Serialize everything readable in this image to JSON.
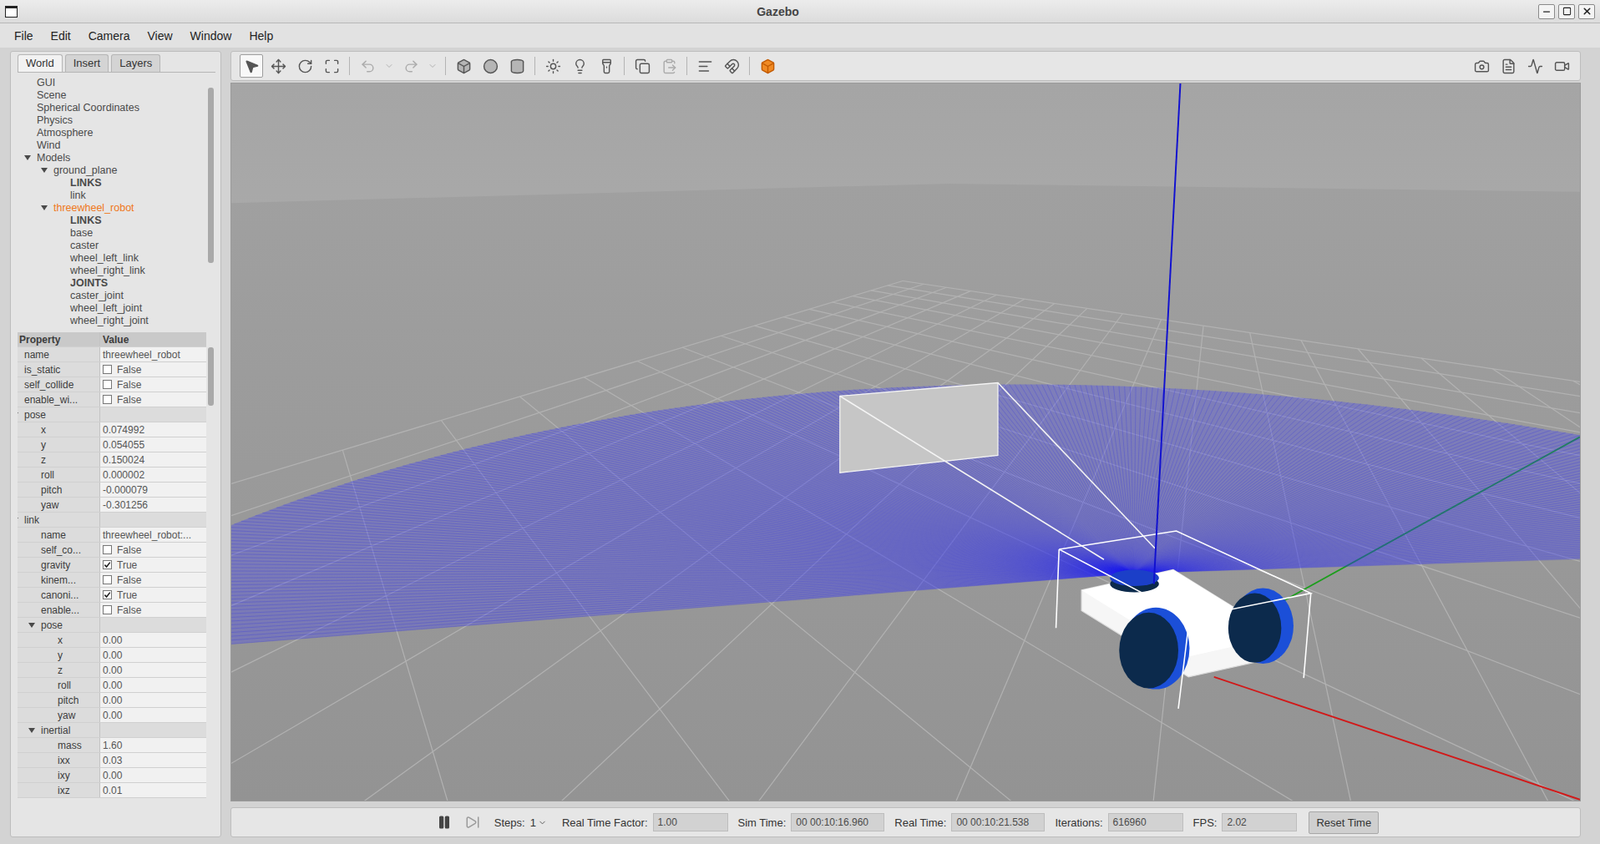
{
  "window": {
    "title": "Gazebo"
  },
  "menu": [
    "File",
    "Edit",
    "Camera",
    "View",
    "Window",
    "Help"
  ],
  "left_panel": {
    "tabs": [
      {
        "label": "World",
        "selected": true
      },
      {
        "label": "Insert",
        "selected": false
      },
      {
        "label": "Layers",
        "selected": false
      }
    ],
    "tree": [
      {
        "label": "GUI",
        "depth": 0,
        "kind": "item",
        "expandable": false,
        "expanded": false,
        "selected": false
      },
      {
        "label": "Scene",
        "depth": 0,
        "kind": "item",
        "expandable": false,
        "expanded": false,
        "selected": false
      },
      {
        "label": "Spherical Coordinates",
        "depth": 0,
        "kind": "item",
        "expandable": false,
        "expanded": false,
        "selected": false
      },
      {
        "label": "Physics",
        "depth": 0,
        "kind": "item",
        "expandable": false,
        "expanded": false,
        "selected": false
      },
      {
        "label": "Atmosphere",
        "depth": 0,
        "kind": "item",
        "expandable": false,
        "expanded": false,
        "selected": false
      },
      {
        "label": "Wind",
        "depth": 0,
        "kind": "item",
        "expandable": false,
        "expanded": false,
        "selected": false
      },
      {
        "label": "Models",
        "depth": 0,
        "kind": "item",
        "expandable": true,
        "expanded": true,
        "selected": false
      },
      {
        "label": "ground_plane",
        "depth": 1,
        "kind": "item",
        "expandable": true,
        "expanded": true,
        "selected": false
      },
      {
        "label": "LINKS",
        "depth": 2,
        "kind": "section",
        "expandable": false,
        "expanded": false,
        "selected": false
      },
      {
        "label": "link",
        "depth": 2,
        "kind": "item",
        "expandable": false,
        "expanded": false,
        "selected": false
      },
      {
        "label": "threewheel_robot",
        "depth": 1,
        "kind": "item",
        "expandable": true,
        "expanded": true,
        "selected": true
      },
      {
        "label": "LINKS",
        "depth": 2,
        "kind": "section",
        "expandable": false,
        "expanded": false,
        "selected": false
      },
      {
        "label": "base",
        "depth": 2,
        "kind": "item",
        "expandable": false,
        "expanded": false,
        "selected": false
      },
      {
        "label": "caster",
        "depth": 2,
        "kind": "item",
        "expandable": false,
        "expanded": false,
        "selected": false
      },
      {
        "label": "wheel_left_link",
        "depth": 2,
        "kind": "item",
        "expandable": false,
        "expanded": false,
        "selected": false
      },
      {
        "label": "wheel_right_link",
        "depth": 2,
        "kind": "item",
        "expandable": false,
        "expanded": false,
        "selected": false
      },
      {
        "label": "JOINTS",
        "depth": 2,
        "kind": "section",
        "expandable": false,
        "expanded": false,
        "selected": false
      },
      {
        "label": "caster_joint",
        "depth": 2,
        "kind": "item",
        "expandable": false,
        "expanded": false,
        "selected": false
      },
      {
        "label": "wheel_left_joint",
        "depth": 2,
        "kind": "item",
        "expandable": false,
        "expanded": false,
        "selected": false
      },
      {
        "label": "wheel_right_joint",
        "depth": 2,
        "kind": "item",
        "expandable": false,
        "expanded": false,
        "selected": false
      }
    ],
    "properties": {
      "columns": [
        "Property",
        "Value"
      ],
      "rows": [
        {
          "label": "name",
          "value": "threewheel_robot",
          "kind": "text",
          "depth": 0
        },
        {
          "label": "is_static",
          "value": "False",
          "kind": "check",
          "checked": false,
          "depth": 0
        },
        {
          "label": "self_collide",
          "value": "False",
          "kind": "check",
          "checked": false,
          "depth": 0
        },
        {
          "label": "enable_wi...",
          "value": "False",
          "kind": "check",
          "checked": false,
          "depth": 0
        },
        {
          "label": "pose",
          "kind": "group",
          "expanded": true,
          "depth": 0
        },
        {
          "label": "x",
          "value": "0.074992",
          "kind": "text",
          "depth": 1
        },
        {
          "label": "y",
          "value": "0.054055",
          "kind": "text",
          "depth": 1
        },
        {
          "label": "z",
          "value": "0.150024",
          "kind": "text",
          "depth": 1
        },
        {
          "label": "roll",
          "value": "0.000002",
          "kind": "text",
          "depth": 1
        },
        {
          "label": "pitch",
          "value": "-0.000079",
          "kind": "text",
          "depth": 1
        },
        {
          "label": "yaw",
          "value": "-0.301256",
          "kind": "text",
          "depth": 1
        },
        {
          "label": "link",
          "kind": "group",
          "expanded": true,
          "depth": 0
        },
        {
          "label": "name",
          "value": "threewheel_robot:...",
          "kind": "text",
          "depth": 1
        },
        {
          "label": "self_co...",
          "value": "False",
          "kind": "check",
          "checked": false,
          "depth": 1
        },
        {
          "label": "gravity",
          "value": "True",
          "kind": "check",
          "checked": true,
          "depth": 1
        },
        {
          "label": "kinem...",
          "value": "False",
          "kind": "check",
          "checked": false,
          "depth": 1
        },
        {
          "label": "canoni...",
          "value": "True",
          "kind": "check",
          "checked": true,
          "depth": 1
        },
        {
          "label": "enable...",
          "value": "False",
          "kind": "check",
          "checked": false,
          "depth": 1
        },
        {
          "label": "pose",
          "kind": "group",
          "expanded": true,
          "depth": 1
        },
        {
          "label": "x",
          "value": "0.00",
          "kind": "text",
          "depth": 2
        },
        {
          "label": "y",
          "value": "0.00",
          "kind": "text",
          "depth": 2
        },
        {
          "label": "z",
          "value": "0.00",
          "kind": "text",
          "depth": 2
        },
        {
          "label": "roll",
          "value": "0.00",
          "kind": "text",
          "depth": 2
        },
        {
          "label": "pitch",
          "value": "0.00",
          "kind": "text",
          "depth": 2
        },
        {
          "label": "yaw",
          "value": "0.00",
          "kind": "text",
          "depth": 2
        },
        {
          "label": "inertial",
          "kind": "group",
          "expanded": true,
          "depth": 1
        },
        {
          "label": "mass",
          "value": "1.60",
          "kind": "text",
          "depth": 2
        },
        {
          "label": "ixx",
          "value": "0.03",
          "kind": "text",
          "depth": 2
        },
        {
          "label": "ixy",
          "value": "0.00",
          "kind": "text",
          "depth": 2
        },
        {
          "label": "ixz",
          "value": "0.01",
          "kind": "text",
          "depth": 2
        }
      ]
    }
  },
  "toolbar": {
    "tools": [
      {
        "kind": "select",
        "selected": true,
        "disabled": false
      },
      {
        "kind": "translate",
        "selected": false,
        "disabled": false
      },
      {
        "kind": "rotate",
        "selected": false,
        "disabled": false
      },
      {
        "kind": "scale",
        "selected": false,
        "disabled": false
      },
      {
        "kind": "separator"
      },
      {
        "kind": "undo",
        "selected": false,
        "disabled": true
      },
      {
        "kind": "dropdown",
        "selected": false,
        "disabled": true
      },
      {
        "kind": "redo",
        "selected": false,
        "disabled": true
      },
      {
        "kind": "dropdown",
        "selected": false,
        "disabled": true
      },
      {
        "kind": "separator"
      },
      {
        "kind": "box",
        "selected": false,
        "disabled": false
      },
      {
        "kind": "sphere",
        "selected": false,
        "disabled": false
      },
      {
        "kind": "cylinder",
        "selected": false,
        "disabled": false
      },
      {
        "kind": "separator"
      },
      {
        "kind": "point_light",
        "selected": false,
        "disabled": false
      },
      {
        "kind": "spot_light",
        "selected": false,
        "disabled": false
      },
      {
        "kind": "directional_light",
        "selected": false,
        "disabled": false
      },
      {
        "kind": "separator"
      },
      {
        "kind": "copy",
        "selected": false,
        "disabled": false
      },
      {
        "kind": "paste",
        "selected": false,
        "disabled": true
      },
      {
        "kind": "separator"
      },
      {
        "kind": "align",
        "selected": false,
        "disabled": false
      },
      {
        "kind": "snap",
        "selected": false,
        "disabled": false
      },
      {
        "kind": "separator"
      },
      {
        "kind": "view_angle",
        "selected": false,
        "disabled": false
      }
    ],
    "right_tools": [
      {
        "kind": "screenshot"
      },
      {
        "kind": "log"
      },
      {
        "kind": "plot"
      },
      {
        "kind": "record"
      }
    ]
  },
  "status_bar": {
    "running": true,
    "steps_label": "Steps:",
    "steps": "1",
    "fields": [
      {
        "label": "Real Time Factor:",
        "value": "1.00"
      },
      {
        "label": "Sim Time:",
        "value": "00 00:10:16.960"
      },
      {
        "label": "Real Time:",
        "value": "00 00:10:21.538"
      },
      {
        "label": "Iterations:",
        "value": "616960"
      },
      {
        "label": "FPS:",
        "value": "2.02"
      }
    ],
    "reset_button": "Reset Time"
  }
}
